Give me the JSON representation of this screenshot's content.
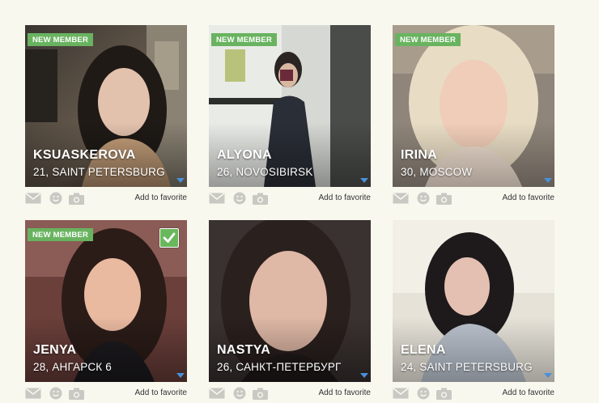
{
  "profiles": [
    {
      "name": "KSUASKEROVA",
      "location": "21, SAINT PETERSBURG",
      "badge": "NEW MEMBER",
      "selected": false,
      "favorite": "Add to favorite"
    },
    {
      "name": "ALYONA",
      "location": "26, NOVOSIBIRSK",
      "badge": "NEW MEMBER",
      "selected": false,
      "favorite": "Add to favorite"
    },
    {
      "name": "IRINA",
      "location": "30, MOSCOW",
      "badge": "NEW MEMBER",
      "selected": false,
      "favorite": "Add to favorite"
    },
    {
      "name": "JENYA",
      "location": "28, АНГАРСК 6",
      "badge": "NEW MEMBER",
      "selected": true,
      "favorite": "Add to favorite"
    },
    {
      "name": "NASTYA",
      "location": "26, САНКТ-ПЕТЕРБУРГ",
      "badge": "",
      "selected": false,
      "favorite": "Add to favorite"
    },
    {
      "name": "ELENA",
      "location": "24, SAINT PETERSBURG",
      "badge": "",
      "selected": false,
      "favorite": "Add to favorite"
    }
  ],
  "icons": {
    "mail": "mail-icon",
    "smile": "smile-icon",
    "camera": "camera-icon",
    "dropdown": "dropdown-arrow-icon",
    "check": "checkmark-icon"
  },
  "colors": {
    "badge": "#69b360",
    "check": "#6ab85c",
    "icon": "#c9c9c3",
    "arrow": "#4a90d9",
    "background": "#f8f8ef"
  }
}
